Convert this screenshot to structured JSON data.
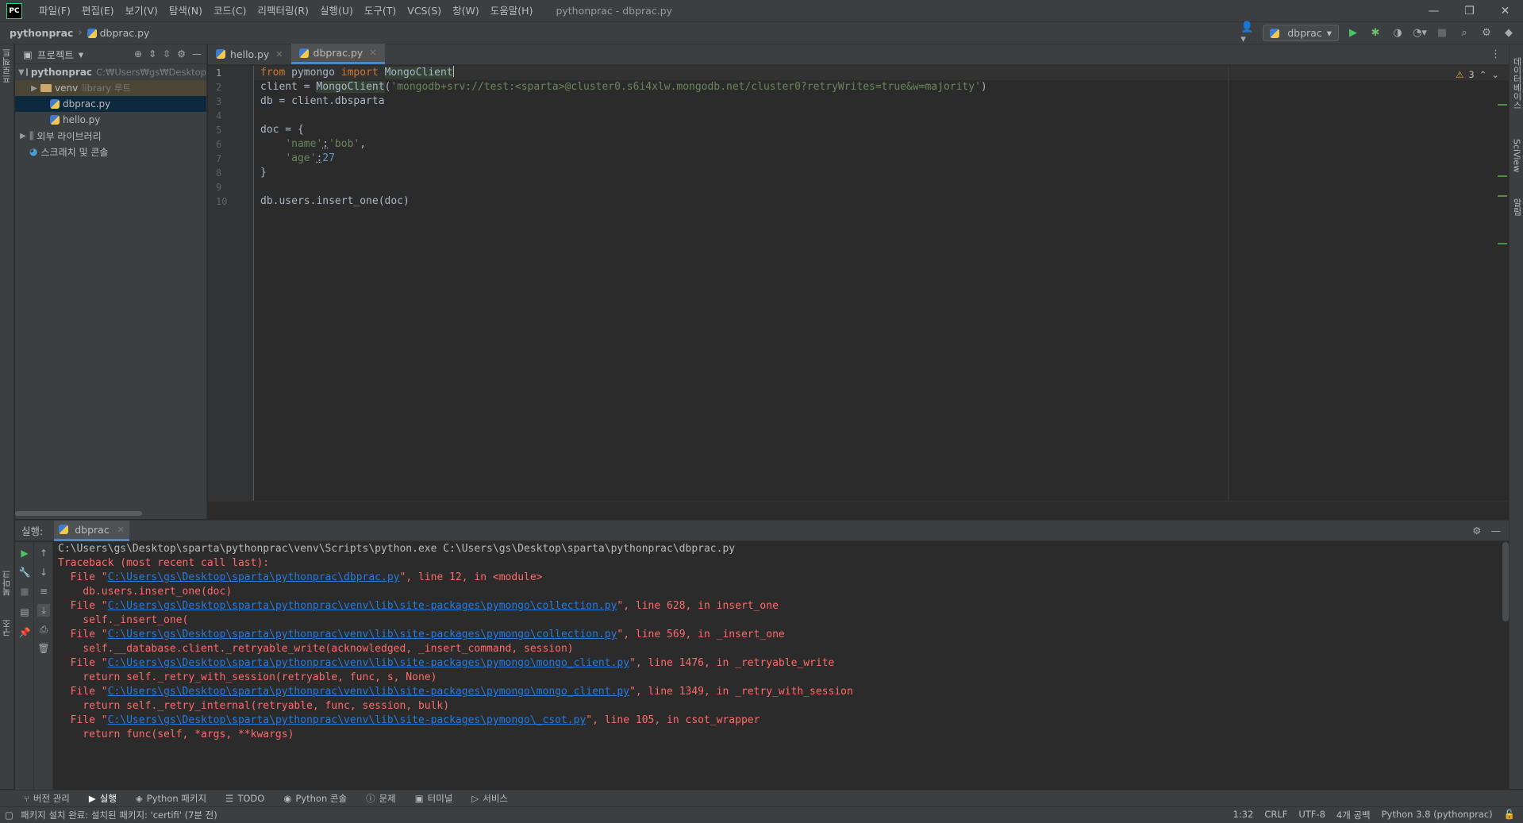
{
  "window": {
    "logo": "PC",
    "title": "pythonprac - dbprac.py",
    "controls": [
      "—",
      "❐",
      "✕"
    ]
  },
  "menu": [
    "파일(F)",
    "편집(E)",
    "보기(V)",
    "탐색(N)",
    "코드(C)",
    "리팩터링(R)",
    "실행(U)",
    "도구(T)",
    "VCS(S)",
    "창(W)",
    "도움말(H)"
  ],
  "breadcrumb": {
    "project": "pythonprac",
    "file": "dbprac.py"
  },
  "run_config": {
    "name": "dbprac"
  },
  "left_strip": {
    "project": "프로젝트",
    "bookmarks": "북마크",
    "structure": "구조"
  },
  "right_strip": {
    "database": "데이터베이스",
    "sciview": "SciView",
    "notifications": "알림"
  },
  "project_panel": {
    "title": "프로젝트",
    "tree": [
      {
        "label": "pythonprac",
        "hint": "C:₩Users₩gs₩Desktop",
        "level": 0
      },
      {
        "label": "venv",
        "hint": "library 루트",
        "level": 1
      },
      {
        "label": "dbprac.py",
        "hint": "",
        "level": 2
      },
      {
        "label": "hello.py",
        "hint": "",
        "level": 2
      },
      {
        "label": "외부 라이브러리",
        "hint": "",
        "level": 0
      },
      {
        "label": "스크래치 및 콘솔",
        "hint": "",
        "level": 0
      }
    ]
  },
  "editor": {
    "tabs": [
      {
        "label": "hello.py",
        "active": false
      },
      {
        "label": "dbprac.py",
        "active": true
      }
    ],
    "warnings": "3",
    "line_numbers": [
      "1",
      "2",
      "3",
      "4",
      "5",
      "6",
      "7",
      "8",
      "9",
      "10"
    ],
    "code": {
      "l1_kw1": "from",
      "l1_mod": " pymongo ",
      "l1_kw2": "import",
      "l1_cls": "MongoClient",
      "l2_a": "client = ",
      "l2_cls": "MongoClient",
      "l2_b": "(",
      "l2_str": "'mongodb+srv://test:<sparta>@cluster0.s6i4xlw.mongodb.net/cluster0?retryWrites=true&w=majority'",
      "l2_c": ")",
      "l3": "db = client.dbsparta",
      "l5": "doc = {",
      "l6_indent": "    ",
      "l6_k": "'name'",
      "l6_colon": ":",
      "l6_v": "'bob'",
      "l6_comma": ",",
      "l7_indent": "    ",
      "l7_k": "'age'",
      "l7_colon": ":",
      "l7_v": "27",
      "l8": "}",
      "l10": "db.users.insert_one(doc)"
    }
  },
  "run_panel": {
    "label": "실행:",
    "tab": "dbprac",
    "console": [
      {
        "type": "plain",
        "text": "C:\\Users\\gs\\Desktop\\sparta\\pythonprac\\venv\\Scripts\\python.exe C:\\Users\\gs\\Desktop\\sparta\\pythonprac\\dbprac.py"
      },
      {
        "type": "err",
        "text": "Traceback (most recent call last):"
      },
      {
        "type": "file",
        "pre": "  File \"",
        "link": "C:\\Users\\gs\\Desktop\\sparta\\pythonprac\\dbprac.py",
        "post": "\", line 12, in <module>"
      },
      {
        "type": "err",
        "text": "    db.users.insert_one(doc)"
      },
      {
        "type": "file",
        "pre": "  File \"",
        "link": "C:\\Users\\gs\\Desktop\\sparta\\pythonprac\\venv\\lib\\site-packages\\pymongo\\collection.py",
        "post": "\", line 628, in insert_one"
      },
      {
        "type": "err",
        "text": "    self._insert_one("
      },
      {
        "type": "file",
        "pre": "  File \"",
        "link": "C:\\Users\\gs\\Desktop\\sparta\\pythonprac\\venv\\lib\\site-packages\\pymongo\\collection.py",
        "post": "\", line 569, in _insert_one"
      },
      {
        "type": "err",
        "text": "    self.__database.client._retryable_write(acknowledged, _insert_command, session)"
      },
      {
        "type": "file",
        "pre": "  File \"",
        "link": "C:\\Users\\gs\\Desktop\\sparta\\pythonprac\\venv\\lib\\site-packages\\pymongo\\mongo_client.py",
        "post": "\", line 1476, in _retryable_write"
      },
      {
        "type": "err",
        "text": "    return self._retry_with_session(retryable, func, s, None)"
      },
      {
        "type": "file",
        "pre": "  File \"",
        "link": "C:\\Users\\gs\\Desktop\\sparta\\pythonprac\\venv\\lib\\site-packages\\pymongo\\mongo_client.py",
        "post": "\", line 1349, in _retry_with_session"
      },
      {
        "type": "err",
        "text": "    return self._retry_internal(retryable, func, session, bulk)"
      },
      {
        "type": "file",
        "pre": "  File \"",
        "link": "C:\\Users\\gs\\Desktop\\sparta\\pythonprac\\venv\\lib\\site-packages\\pymongo\\_csot.py",
        "post": "\", line 105, in csot_wrapper"
      },
      {
        "type": "err",
        "text": "    return func(self, *args, **kwargs)"
      }
    ]
  },
  "tool_strip": [
    "버전 관리",
    "실행",
    "Python 패키지",
    "TODO",
    "Python 콘솔",
    "문제",
    "터미널",
    "서비스"
  ],
  "status": {
    "message": "패키지 설치 완료: 설치된 패키지: 'certifi' (7분 전)",
    "position": "1:32",
    "line_ending": "CRLF",
    "encoding": "UTF-8",
    "indent": "4개 공백",
    "interpreter": "Python 3.8 (pythonprac)"
  },
  "colors": {
    "keyword": "#cc7832",
    "string": "#6a8759",
    "number": "#6897bb",
    "error_text": "#ff6b68",
    "link": "#287bde",
    "accent": "#4a88c7"
  }
}
